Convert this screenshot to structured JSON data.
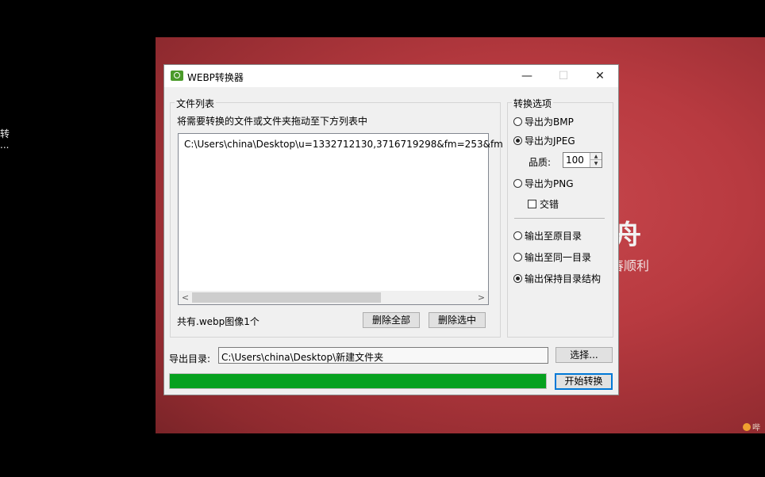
{
  "desktop": {
    "left_text": [
      "转",
      "..."
    ],
    "wallpaper_big_text": "舟",
    "wallpaper_small_text": "舂顺利",
    "watermark": "哔",
    "accent": "#c0444a"
  },
  "window": {
    "title": "WEBP转换器",
    "controls": {
      "minimize": "—",
      "maximize": "☐",
      "close": "✕"
    },
    "file_list": {
      "group_label": "文件列表",
      "instruction": "将需要转换的文件或文件夹拖动至下方列表中",
      "items": [
        "C:\\Users\\china\\Desktop\\u=1332712130,3716719298&fm=253&fm"
      ],
      "scroll_left": "<",
      "scroll_right": ">",
      "count_text": "共有.webp图像1个",
      "delete_all": "删除全部",
      "delete_selected": "删除选中"
    },
    "options": {
      "group_label": "转换选项",
      "export_bmp": "导出为BMP",
      "export_jpeg": "导出为JPEG",
      "quality_label": "品质:",
      "quality_value": "100",
      "export_png": "导出为PNG",
      "interlace": "交错",
      "out_original": "输出至原目录",
      "out_same": "输出至同一目录",
      "out_keep_structure": "输出保持目录结构",
      "selected_format": "jpeg",
      "selected_output": "keep_structure"
    },
    "output": {
      "label": "导出目录:",
      "path": "C:\\Users\\china\\Desktop\\新建文件夹",
      "choose": "选择...",
      "start": "开始转换",
      "progress": 1.0,
      "progress_color": "#06a11f"
    }
  }
}
